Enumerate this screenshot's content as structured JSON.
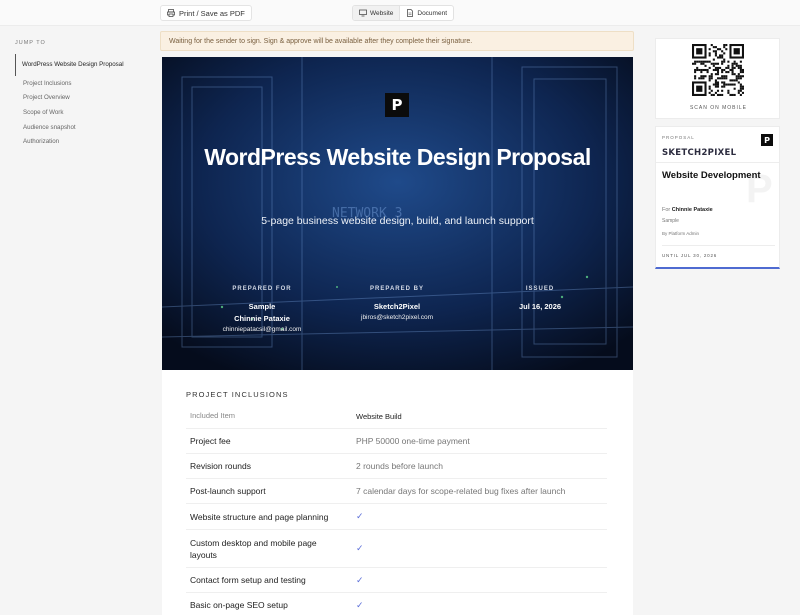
{
  "toolbar": {
    "print_label": "Print / Save as PDF",
    "view_website": "Website",
    "view_document": "Document"
  },
  "sidebar": {
    "heading": "JUMP TO",
    "items": [
      {
        "label": "WordPress Website Design Proposal"
      },
      {
        "label": "Project Inclusions"
      },
      {
        "label": "Project Overview"
      },
      {
        "label": "Scope of Work"
      },
      {
        "label": "Audience snapshot"
      },
      {
        "label": "Authorization"
      }
    ]
  },
  "banner": {
    "text": "Waiting for the sender to sign. Sign & approve will be available after they complete their signature."
  },
  "hero": {
    "logo_glyph": "P",
    "bg_text": "NETWORK 3",
    "title": "WordPress Website Design Proposal",
    "subtitle": "5-page business website design, build, and launch support",
    "prepared_for_label": "PREPARED FOR",
    "prepared_for_company": "Sample",
    "prepared_for_name": "Chinnie Pataxie",
    "prepared_for_email": "chinniepatacsil@gmail.com",
    "prepared_by_label": "PREPARED BY",
    "prepared_by_company": "Sketch2Pixel",
    "prepared_by_email": "jbiros@sketch2pixel.com",
    "issued_label": "ISSUED",
    "issued_date": "Jul 16, 2026"
  },
  "inclusions": {
    "title": "PROJECT INCLUSIONS",
    "col_item": "Included Item",
    "col_value": "Website Build",
    "rows": [
      {
        "item": "Project fee",
        "value": "PHP 50000 one-time payment"
      },
      {
        "item": "Revision rounds",
        "value": "2 rounds before launch"
      },
      {
        "item": "Post-launch support",
        "value": "7 calendar days for scope-related bug fixes after launch"
      },
      {
        "item": "Website structure and page planning",
        "value": "✓"
      },
      {
        "item": "Custom desktop and mobile page layouts",
        "value": "✓"
      },
      {
        "item": "Contact form setup and testing",
        "value": "✓"
      },
      {
        "item": "Basic on-page SEO setup",
        "value": "✓"
      }
    ]
  },
  "qr": {
    "label": "SCAN ON MOBILE"
  },
  "proposal_card": {
    "label": "PROPOSAL",
    "logo_glyph": "P",
    "brand": "SKETCH2PIXEL",
    "title": "Website Development",
    "for_prefix": "For",
    "for_name": "Chinnie Pataxie",
    "company": "Sample",
    "by": "By Platform Admin",
    "until": "UNTIL JUL 30, 2026",
    "watermark": "P"
  },
  "colors": {
    "accent": "#4f6bd1",
    "banner_bg": "#faf0e2",
    "hero_bg": "#0a1730"
  }
}
